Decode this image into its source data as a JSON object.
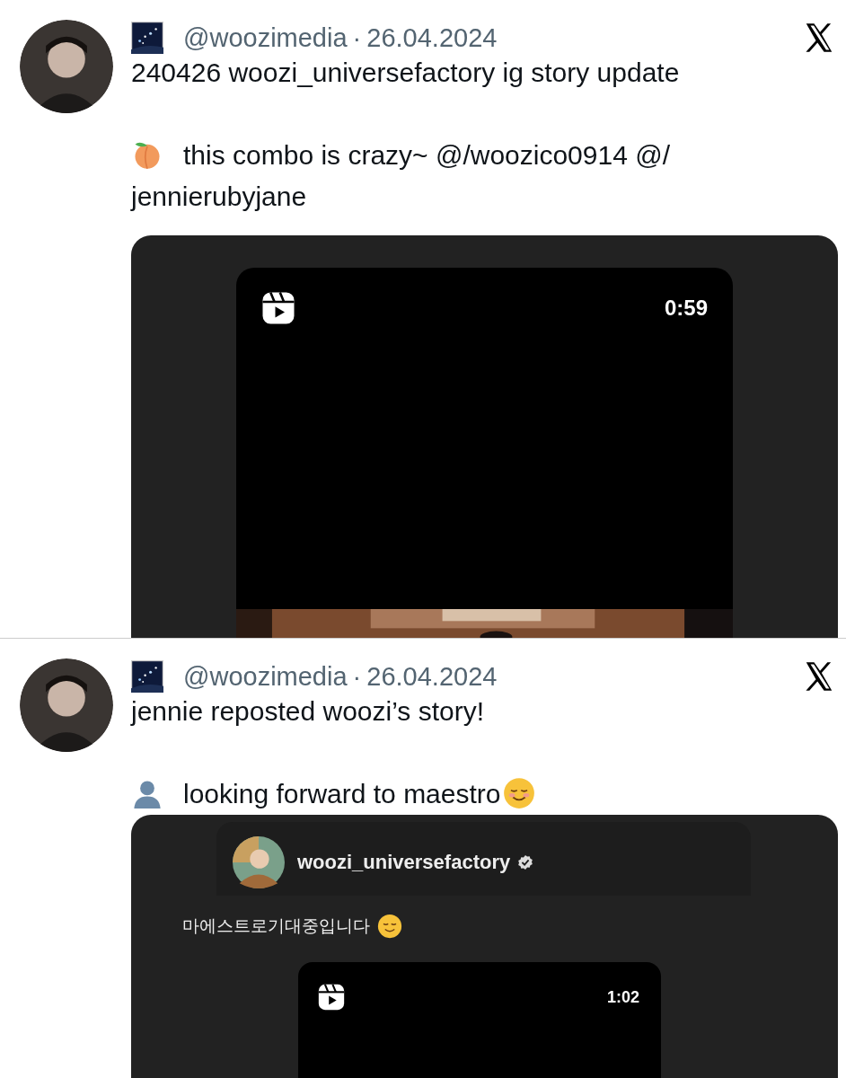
{
  "posts": [
    {
      "handle": "@woozimedia",
      "separator": "·",
      "date": "26.04.2024",
      "paragraphs": [
        [
          {
            "kind": "text",
            "text": "240426 woozi_universefactory ig story update"
          }
        ],
        [
          {
            "kind": "peach"
          },
          {
            "kind": "text",
            "text": "this combo is crazy~ @/woozico0914 @/"
          },
          {
            "kind": "line",
            "text": "jennierubyjane"
          }
        ]
      ],
      "media": {
        "kind": "reel",
        "duration": "0:59"
      }
    },
    {
      "handle": "@woozimedia",
      "separator": "·",
      "date": "26.04.2024",
      "paragraphs": [
        [
          {
            "kind": "text",
            "text": "jennie reposted woozi’s story!"
          }
        ],
        [
          {
            "kind": "bust"
          },
          {
            "kind": "text",
            "text": "looking forward to maestro"
          },
          {
            "kind": "smile"
          }
        ]
      ],
      "media": {
        "kind": "story_repost",
        "username": "woozi_universefactory",
        "verified": true,
        "caption": [
          {
            "kind": "text",
            "text": "마에스트로기대중입니다"
          },
          {
            "kind": "smile"
          }
        ],
        "duration": "1:02"
      }
    }
  ]
}
